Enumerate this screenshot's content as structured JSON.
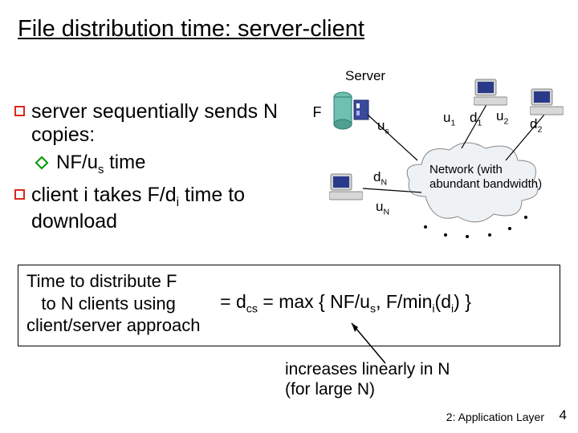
{
  "title": "File distribution time: server-client",
  "bullets": {
    "b1": "server sequentially sends N copies:",
    "b1sub": "NF/u",
    "b1sub_sub": "s",
    "b1sub_tail": " time",
    "b2_a": "client i takes F/d",
    "b2_sub": "i",
    "b2_b": " time to download"
  },
  "diagram": {
    "server": "Server",
    "F": "F",
    "us": "u",
    "us_sub": "s",
    "u1": "u",
    "u1_sub": "1",
    "d1": "d",
    "d1_sub": "1",
    "u2": "u",
    "u2_sub": "2",
    "d2": "d",
    "d2_sub": "2",
    "dN": "d",
    "dN_sub": "N",
    "uN": "u",
    "uN_sub": "N",
    "network_a": "Network (with",
    "network_b": "abundant bandwidth)"
  },
  "formula": {
    "left1": "Time to  distribute F",
    "left2": "   to N clients using",
    "left3": "client/server approach",
    "right": " = d",
    "right_sub": "cs",
    "right2": " = max { NF/u",
    "right2_sub": "s",
    "right3": ", F/min",
    "right3_sub": "i",
    "right4": "(d",
    "right4_sub": "i",
    "right5": ") }"
  },
  "footnote": {
    "l1": "increases linearly in N",
    "l2": "(for large N)"
  },
  "chapter": "2: Application Layer",
  "pagenum": "4",
  "colors": {
    "accent_red": "#d9281a",
    "accent_green": "#009900"
  }
}
